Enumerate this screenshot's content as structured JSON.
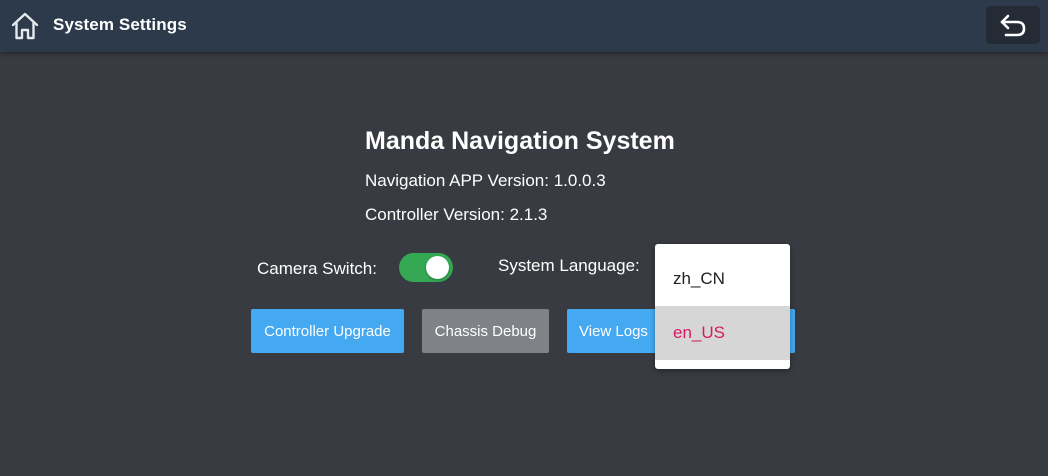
{
  "header": {
    "title": "System Settings",
    "home_icon": "home-icon",
    "back_icon": "back-arrow-icon"
  },
  "main": {
    "app_title": "Manda Navigation System",
    "app_version": "Navigation APP Version: 1.0.0.3",
    "controller_version": "Controller Version: 2.1.3",
    "camera_switch": {
      "label": "Camera Switch:",
      "state": "on",
      "color": "#34a853"
    },
    "system_language": {
      "label": "System Language:",
      "options": [
        "zh_CN",
        "en_US"
      ],
      "selected": "en_US",
      "selected_color": "#d81b60"
    },
    "buttons": {
      "controller_upgrade": "Controller Upgrade",
      "chassis_debug": "Chassis Debug",
      "view_logs": "View Logs"
    }
  },
  "colors": {
    "background": "#383b41",
    "header": "#2c3a4c",
    "primary_button": "#45a9f2",
    "disabled_button": "#7f8387"
  }
}
